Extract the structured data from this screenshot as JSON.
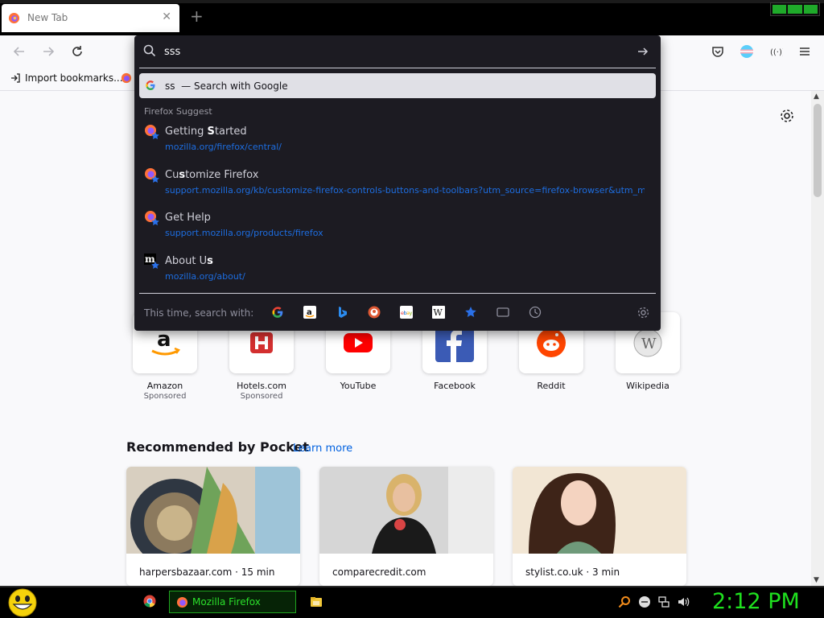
{
  "browser": {
    "tab_title": "New Tab",
    "bookmark_import": "Import bookmarks..."
  },
  "urlbar": {
    "value": "sss",
    "google_query": "ss",
    "google_suffix": "— Search with Google",
    "suggest_header": "Firefox Suggest",
    "search_with_label": "This time, search with:",
    "engines": [
      "google-icon",
      "amazon-icon",
      "bing-icon",
      "duckduckgo-icon",
      "ebay-icon",
      "wikipedia-icon",
      "bookmarks-icon",
      "tabs-icon",
      "history-icon"
    ],
    "suggestions": [
      {
        "title_pre": "Getting ",
        "title_bold": "S",
        "title_post": "tarted",
        "url": "mozilla.org/firefox/central/"
      },
      {
        "title_pre": "Cu",
        "title_bold": "s",
        "title_post": "tomize Firefox",
        "url": "support.mozilla.org/kb/customize-firefox-controls-buttons-and-toolbars?utm_source=firefox-browser&utm_me"
      },
      {
        "title_pre": "Get Help",
        "title_bold": "",
        "title_post": "",
        "url": "support.mozilla.org/products/firefox"
      },
      {
        "title_pre": "About U",
        "title_bold": "s",
        "title_post": "",
        "url": "mozilla.org/about/"
      }
    ]
  },
  "top_sites": [
    {
      "name": "Amazon",
      "sponsored": "Sponsored"
    },
    {
      "name": "Hotels.com",
      "sponsored": "Sponsored"
    },
    {
      "name": "YouTube",
      "sponsored": ""
    },
    {
      "name": "Facebook",
      "sponsored": ""
    },
    {
      "name": "Reddit",
      "sponsored": ""
    },
    {
      "name": "Wikipedia",
      "sponsored": ""
    }
  ],
  "pocket": {
    "title": "Recommended by Pocket",
    "learn_more": "Learn more",
    "cards": [
      {
        "source": "harpersbazaar.com · 15 min"
      },
      {
        "source": "comparecredit.com"
      },
      {
        "source": "stylist.co.uk · 3 min"
      }
    ]
  },
  "taskbar": {
    "firefox_label": "Mozilla Firefox",
    "clock": "2:12 PM"
  },
  "colors": {
    "accent_link": "#0061e0",
    "popup_bg": "#1c1b22",
    "taskbar_green": "#1fe01f"
  }
}
